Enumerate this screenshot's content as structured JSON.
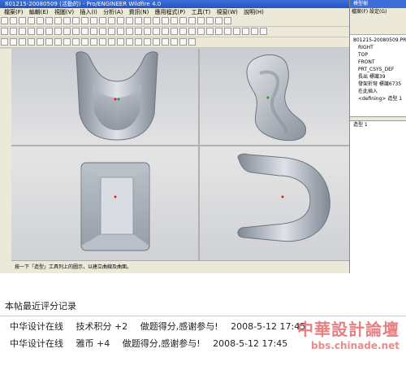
{
  "window": {
    "title": "801215-20080509 (活動的) - Pro/ENGINEER Wildfire 4.0"
  },
  "menubar": {
    "items": [
      "檔案(F)",
      "編輯(E)",
      "視圖(V)",
      "插入(I)",
      "分析(A)",
      "資訊(N)",
      "應用程式(P)",
      "工具(T)",
      "視窗(W)",
      "說明(H)"
    ]
  },
  "status": {
    "message": "按一下「造型」工具列上的圖示，以建立曲線及曲面。"
  },
  "model_tree": {
    "panel_title": "模型樹",
    "menu": "檔案(F)  設定(G)",
    "items": [
      {
        "label": "801215-20080509.PRT",
        "indent": false
      },
      {
        "label": "RIGHT",
        "indent": true
      },
      {
        "label": "TOP",
        "indent": true
      },
      {
        "label": "FRONT",
        "indent": true
      },
      {
        "label": "PRT_CSYS_DEF",
        "indent": true
      },
      {
        "label": "長出 標識39",
        "indent": true
      },
      {
        "label": "發架折彎 標識6735",
        "indent": true
      },
      {
        "label": "在此插入",
        "indent": true
      },
      {
        "label": "<defining> 造型 1",
        "indent": true
      }
    ],
    "lower_label": "造型 1"
  },
  "ratings": {
    "title": "本帖最近评分记录",
    "rows": [
      {
        "user": "中华设计在线",
        "type": "技术积分 +2",
        "reason": "做题得分,感谢参与!",
        "time": "2008-5-12 17:45"
      },
      {
        "user": "中华设计在线",
        "type": "雅币 +4",
        "reason": "做题得分,感谢参与!",
        "time": "2008-5-12 17:45"
      }
    ]
  },
  "watermark": {
    "line1": "中華設計論壇",
    "line2": "bbs.chinade.net"
  },
  "colors": {
    "accent": "#2454c4",
    "model": "#9aa3ae",
    "watermark": "#e06060"
  }
}
